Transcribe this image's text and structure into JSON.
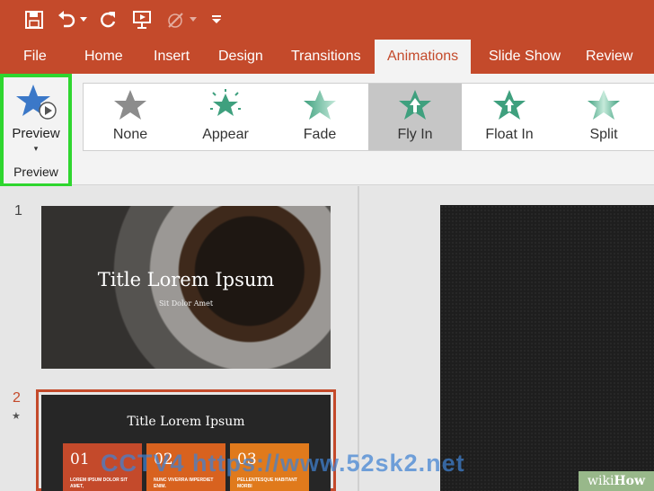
{
  "tabs": [
    "File",
    "Home",
    "Insert",
    "Design",
    "Transitions",
    "Animations",
    "Slide Show",
    "Review"
  ],
  "active_tab": "Animations",
  "preview": {
    "button_label": "Preview",
    "group_label": "Preview"
  },
  "animations": [
    {
      "label": "None",
      "color": "#8c8c8c"
    },
    {
      "label": "Appear",
      "color": "#3fa07e"
    },
    {
      "label": "Fade",
      "color": "#6cc3a3"
    },
    {
      "label": "Fly In",
      "color": "#3fa07e"
    },
    {
      "label": "Float In",
      "color": "#3fa07e"
    },
    {
      "label": "Split",
      "color": "#3fa07e"
    }
  ],
  "selected_animation": "Fly In",
  "slides": [
    {
      "number": "1",
      "title": "Title Lorem Ipsum",
      "subtitle": "Sit Dolor Amet"
    },
    {
      "number": "2",
      "title": "Title Lorem Ipsum",
      "boxes": [
        {
          "num": "01",
          "text": "LOREM IPSUM DOLOR SIT AMET,",
          "color": "#c44a2b"
        },
        {
          "num": "02",
          "text": "NUNC VIVERRA IMPERDIET ENIM.",
          "color": "#d8621f"
        },
        {
          "num": "03",
          "text": "PELLENTESQUE HABITANT MORBI",
          "color": "#e07a1c"
        }
      ]
    }
  ],
  "watermark": "CCTV4 https://www.52sk2.net",
  "logo": {
    "wiki": "wiki",
    "how": "How"
  },
  "colors": {
    "accent": "#c44a2b",
    "highlight": "#2fd62f",
    "preview_star": "#3b78c8"
  }
}
